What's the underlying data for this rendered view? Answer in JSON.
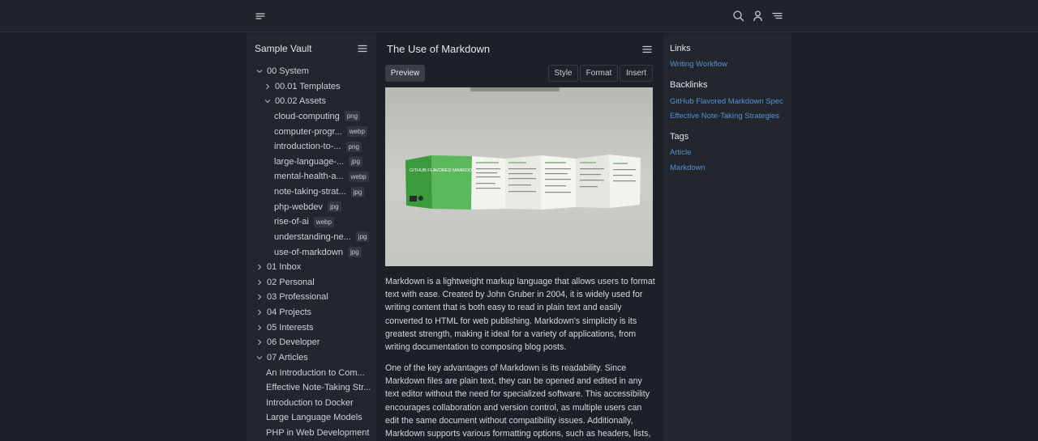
{
  "topbar": {
    "menu_icon": "hamburger-icon",
    "search_icon": "search-icon",
    "user_icon": "user-icon",
    "right_menu_icon": "list-menu-icon"
  },
  "sidebar": {
    "title": "Sample Vault",
    "menu_icon": "hamburger-icon",
    "tree": [
      {
        "label": "00 System",
        "expanded": true,
        "level": 0
      },
      {
        "label": "00.01 Templates",
        "expanded": false,
        "level": 1
      },
      {
        "label": "00.02 Assets",
        "expanded": true,
        "level": 1
      },
      {
        "label": "cloud-computing",
        "ext": "png",
        "level": 2
      },
      {
        "label": "computer-progr...",
        "ext": "webp",
        "level": 2
      },
      {
        "label": "introduction-to-...",
        "ext": "png",
        "level": 2
      },
      {
        "label": "large-language-...",
        "ext": "jpg",
        "level": 2
      },
      {
        "label": "mental-health-a...",
        "ext": "webp",
        "level": 2
      },
      {
        "label": "note-taking-strat...",
        "ext": "jpg",
        "level": 2
      },
      {
        "label": "php-webdev",
        "ext": "jpg",
        "level": 2
      },
      {
        "label": "rise-of-ai",
        "ext": "webp",
        "level": 2
      },
      {
        "label": "understanding-ne...",
        "ext": "jpg",
        "level": 2
      },
      {
        "label": "use-of-markdown",
        "ext": "jpg",
        "level": 2
      },
      {
        "label": "01 Inbox",
        "expanded": false,
        "level": 0
      },
      {
        "label": "02 Personal",
        "expanded": false,
        "level": 0
      },
      {
        "label": "03 Professional",
        "expanded": false,
        "level": 0
      },
      {
        "label": "04 Projects",
        "expanded": false,
        "level": 0
      },
      {
        "label": "05 Interests",
        "expanded": false,
        "level": 0
      },
      {
        "label": "06 Developer",
        "expanded": false,
        "level": 0
      },
      {
        "label": "07 Articles",
        "expanded": true,
        "level": 0
      },
      {
        "label": "An Introduction to Com...",
        "level": 1,
        "file": true
      },
      {
        "label": "Effective Note-Taking Str...",
        "level": 1,
        "file": true
      },
      {
        "label": "Introduction to Docker",
        "level": 1,
        "file": true
      },
      {
        "label": "Large Language Models",
        "level": 1,
        "file": true
      },
      {
        "label": "PHP in Web Development",
        "level": 1,
        "file": true
      }
    ]
  },
  "main": {
    "title": "The Use of Markdown",
    "menu_icon": "hamburger-icon",
    "preview_label": "Preview",
    "style_label": "Style",
    "format_label": "Format",
    "insert_label": "Insert",
    "image_text": {
      "cover": "GITHUB FLAVORED MARKDOWN"
    },
    "paragraphs": [
      "Markdown is a lightweight markup language that allows users to format text with ease. Created by John Gruber in 2004, it is widely used for writing content that is both easy to read in plain text and easily converted to HTML for web publishing. Markdown's simplicity is its greatest strength, making it ideal for a variety of applications, from writing documentation to composing blog posts.",
      "One of the key advantages of Markdown is its readability. Since Markdown files are plain text, they can be opened and edited in any text editor without the need for specialized software. This accessibility encourages collaboration and version control, as multiple users can edit the same document without compatibility issues. Additionally, Markdown supports various formatting options, such as headers, lists,"
    ]
  },
  "right": {
    "links_heading": "Links",
    "links": [
      "Writing Workflow"
    ],
    "backlinks_heading": "Backlinks",
    "backlinks": [
      "GitHub Flavored Markdown Spec",
      "Effective Note-Taking Strategies"
    ],
    "tags_heading": "Tags",
    "tags": [
      "Article",
      "Markdown"
    ],
    "link_color": "#5b8fd6"
  }
}
